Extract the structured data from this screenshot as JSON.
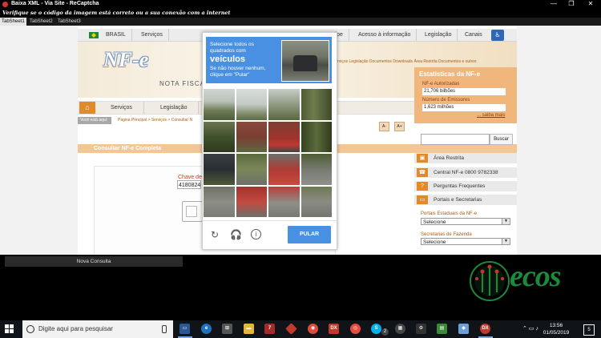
{
  "window": {
    "title": "Baixa XML - Via Site - ReCaptcha",
    "message": "Verifique se o código da imagem está correto ou a sua conexão com a internet",
    "tabs": [
      "TabSheet1",
      "TabSheet2",
      "TabSheet3"
    ],
    "controls": [
      "—",
      "❐",
      "✕"
    ]
  },
  "site": {
    "gov_bar": {
      "country": "BRASIL",
      "items": [
        "Serviços",
        "cipe",
        "Acesso à informação",
        "Legislação",
        "Canais"
      ]
    },
    "hero": {
      "logo": "NF-e",
      "subtitle": "NOTA FISCA",
      "links": "Serviços  Legislação  Documentos  Downloads  Área Restrita  Documentos e outros"
    },
    "nav": [
      "Serviços",
      "Legislação"
    ],
    "breadcrumb": {
      "label": "Você está aqui:",
      "path": "Página Principal > Serviços > Consultar N"
    },
    "font_buttons": [
      "A-",
      "A+"
    ],
    "section_title": "Consultar NF-e Completa",
    "form": {
      "chave_label": "Chave de",
      "chave_value": "4180824"
    }
  },
  "stats": {
    "title": "Estatísticas da NF-e",
    "items": [
      {
        "label": "NF-e Autorizadas",
        "value": "21,706 bilhões"
      },
      {
        "label": "Número de Emissores",
        "value": "1,623 milhões"
      }
    ],
    "more": "... saiba mais"
  },
  "sidebar_right": {
    "search_button": "Buscar",
    "links": [
      "Área Restrita",
      "Central NF-e 0800 9782338",
      "Perguntas Frequentes",
      "Portais e Secretarias"
    ],
    "selects": [
      {
        "label": "Portais Estaduais da NF-e",
        "value": "Selecione"
      },
      {
        "label": "Secretarias de Fazenda",
        "value": "Selecione"
      }
    ]
  },
  "captcha": {
    "instruction_line1": "Selecione todos os quadrados com",
    "target": "veículos",
    "instruction_line2": "Se não houver nenhum, clique em \"Pular\"",
    "skip_button": "PULAR"
  },
  "bottom": {
    "new_query": "Nova Consulta",
    "brand": "ecos"
  },
  "taskbar": {
    "search_placeholder": "Digite aqui para pesquisar",
    "time": "13:56",
    "date": "01/05/2019",
    "notifications": "5",
    "badge": "2"
  }
}
